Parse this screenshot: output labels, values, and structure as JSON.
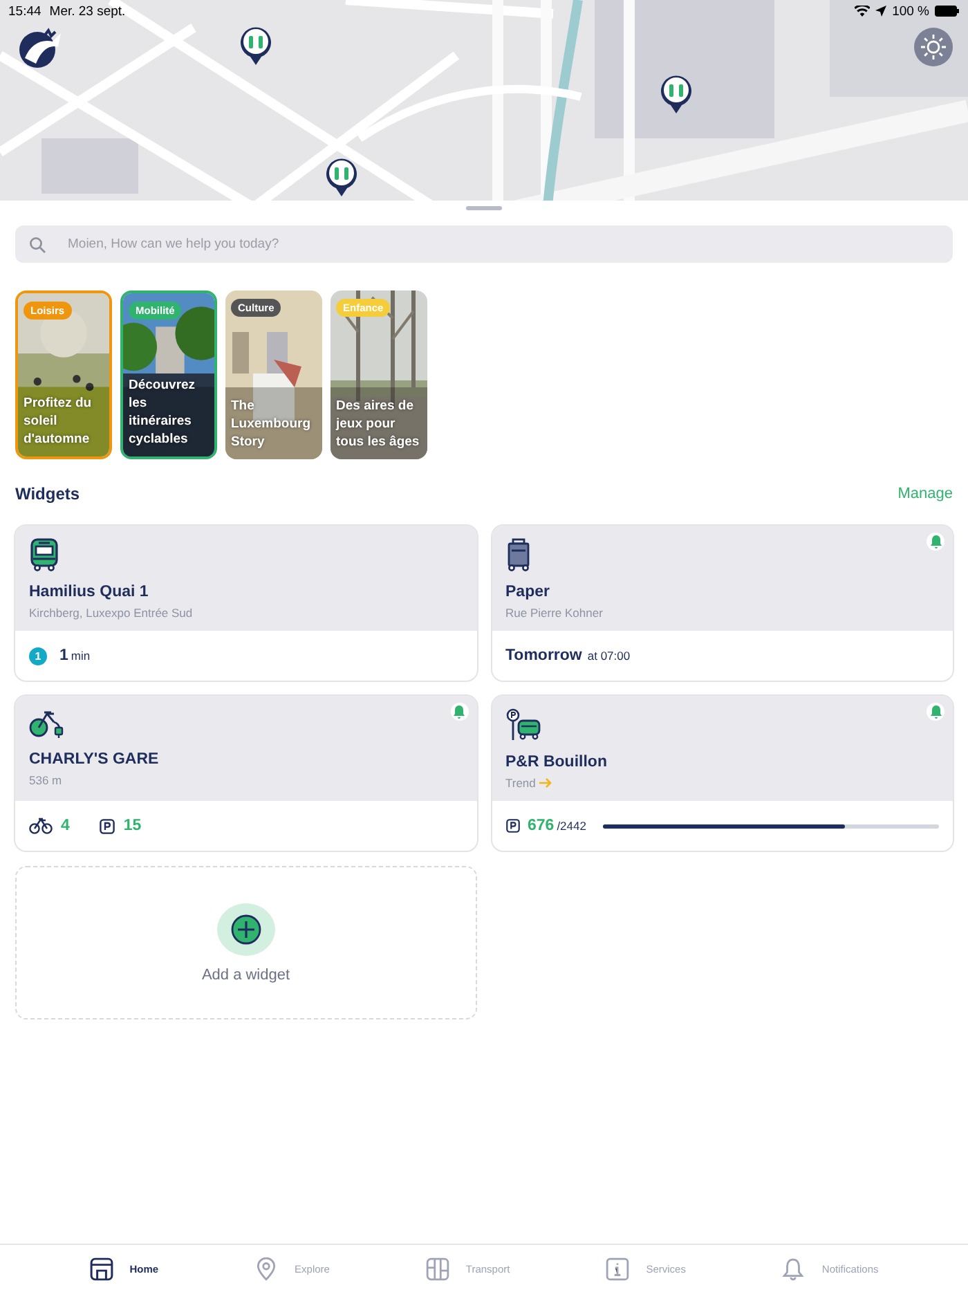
{
  "status_bar": {
    "time": "15:44",
    "date": "Mer. 23 sept.",
    "battery": "100 %"
  },
  "search": {
    "placeholder": "Moien, How can we help you today?"
  },
  "stories": [
    {
      "tag": "Loisirs",
      "color": "#f0960e",
      "title": "Profitez du soleil d'automne",
      "viewed": false
    },
    {
      "tag": "Mobilité",
      "color": "#2fb36e",
      "title": "Découvrez les itinéraires cyclables",
      "viewed": false
    },
    {
      "tag": "Culture",
      "color": "#555555",
      "title": "The Luxembourg Story",
      "viewed": true
    },
    {
      "tag": "Enfance",
      "color": "#f5cc3a",
      "title": "Des aires de jeux pour tous les âges",
      "viewed": true
    }
  ],
  "widgets_header": {
    "title": "Widgets",
    "action": "Manage"
  },
  "widgets": [
    {
      "kind": "bus",
      "title": "Hamilius Quai 1",
      "subtitle": "Kirchberg, Luxexpo Entrée Sud",
      "notify": false,
      "line": "1",
      "value": "1",
      "unit": "min"
    },
    {
      "kind": "waste",
      "title": "Paper",
      "subtitle": "Rue Pierre Kohner",
      "notify": true,
      "value": "Tomorrow",
      "unit": "at 07:00"
    },
    {
      "kind": "bike",
      "title": "CHARLY'S GARE",
      "subtitle": "536 m",
      "notify": true,
      "bikes": "4",
      "docks": "15"
    },
    {
      "kind": "parking",
      "title": "P&R Bouillon",
      "subtitle": "Trend",
      "notify": true,
      "value": "676",
      "unit": "/2442",
      "level": 0.72
    }
  ],
  "add_widget": {
    "label": "Add a widget"
  },
  "tabs": [
    {
      "label": "Home",
      "selected": true
    },
    {
      "label": "Explore",
      "selected": false
    },
    {
      "label": "Transport",
      "selected": false
    },
    {
      "label": "Services",
      "selected": false
    },
    {
      "label": "Notifications",
      "selected": false
    }
  ]
}
